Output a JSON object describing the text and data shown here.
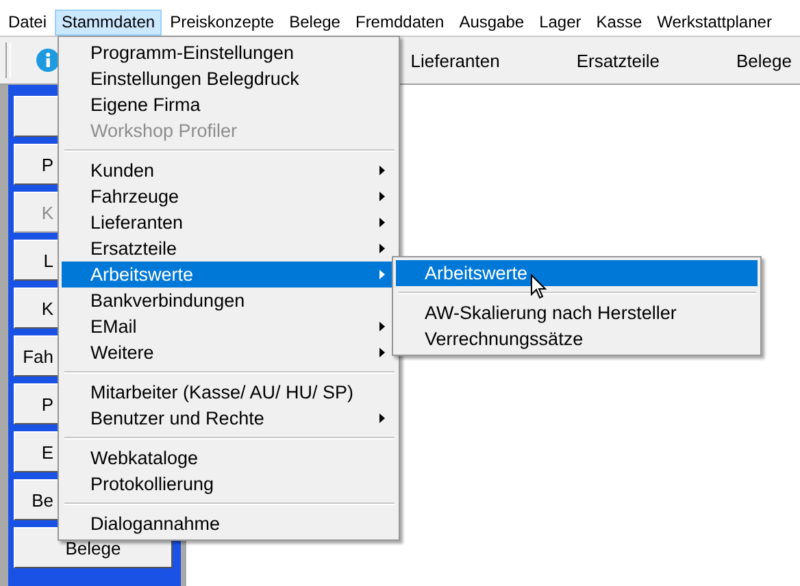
{
  "menu_bar": [
    {
      "label": "Datei",
      "selected": false
    },
    {
      "label": "Stammdaten",
      "selected": true
    },
    {
      "label": "Preiskonzepte",
      "selected": false
    },
    {
      "label": "Belege",
      "selected": false
    },
    {
      "label": "Fremddaten",
      "selected": false
    },
    {
      "label": "Ausgabe",
      "selected": false
    },
    {
      "label": "Lager",
      "selected": false
    },
    {
      "label": "Kasse",
      "selected": false
    },
    {
      "label": "Werkstattplaner",
      "selected": false
    }
  ],
  "toolbar": {
    "items": [
      "Lieferanten",
      "Ersatzteile",
      "Belege"
    ]
  },
  "sidebar": {
    "buttons": [
      {
        "kind": "partial",
        "disabled": false
      },
      {
        "kind": "partial",
        "label": "P",
        "disabled": false
      },
      {
        "kind": "partial",
        "label": "K",
        "disabled": true
      },
      {
        "kind": "partial",
        "label": "L",
        "disabled": false
      },
      {
        "kind": "partial",
        "label": "K",
        "disabled": false
      },
      {
        "kind": "partial",
        "label": "Fah",
        "disabled": false
      },
      {
        "kind": "partial",
        "label": "P",
        "disabled": false
      },
      {
        "kind": "partial",
        "label": "E",
        "disabled": false
      },
      {
        "kind": "partial",
        "label": "Be",
        "disabled": false
      },
      {
        "kind": "full",
        "label": "Belege",
        "disabled": false
      }
    ]
  },
  "stammdaten_menu": [
    {
      "kind": "item",
      "label": "Programm-Einstellungen",
      "submenu": false,
      "disabled": false,
      "selected": false
    },
    {
      "kind": "item",
      "label": "Einstellungen Belegdruck",
      "submenu": false,
      "disabled": false,
      "selected": false
    },
    {
      "kind": "item",
      "label": "Eigene Firma",
      "submenu": false,
      "disabled": false,
      "selected": false
    },
    {
      "kind": "item",
      "label": "Workshop Profiler",
      "submenu": false,
      "disabled": true,
      "selected": false
    },
    {
      "kind": "separator"
    },
    {
      "kind": "item",
      "label": "Kunden",
      "submenu": true,
      "disabled": false,
      "selected": false
    },
    {
      "kind": "item",
      "label": "Fahrzeuge",
      "submenu": true,
      "disabled": false,
      "selected": false
    },
    {
      "kind": "item",
      "label": "Lieferanten",
      "submenu": true,
      "disabled": false,
      "selected": false
    },
    {
      "kind": "item",
      "label": "Ersatzteile",
      "submenu": true,
      "disabled": false,
      "selected": false
    },
    {
      "kind": "item",
      "label": "Arbeitswerte",
      "submenu": true,
      "disabled": false,
      "selected": true
    },
    {
      "kind": "item",
      "label": "Bankverbindungen",
      "submenu": false,
      "disabled": false,
      "selected": false
    },
    {
      "kind": "item",
      "label": "EMail",
      "submenu": true,
      "disabled": false,
      "selected": false
    },
    {
      "kind": "item",
      "label": "Weitere",
      "submenu": true,
      "disabled": false,
      "selected": false
    },
    {
      "kind": "separator"
    },
    {
      "kind": "item",
      "label": "Mitarbeiter (Kasse/ AU/ HU/ SP)",
      "submenu": false,
      "disabled": false,
      "selected": false
    },
    {
      "kind": "item",
      "label": "Benutzer und Rechte",
      "submenu": true,
      "disabled": false,
      "selected": false
    },
    {
      "kind": "separator"
    },
    {
      "kind": "item",
      "label": "Webkataloge",
      "submenu": false,
      "disabled": false,
      "selected": false
    },
    {
      "kind": "item",
      "label": "Protokollierung",
      "submenu": false,
      "disabled": false,
      "selected": false
    },
    {
      "kind": "separator"
    },
    {
      "kind": "item",
      "label": "Dialogannahme",
      "submenu": false,
      "disabled": false,
      "selected": false
    }
  ],
  "arbeitswerte_submenu": [
    {
      "kind": "item",
      "label": "Arbeitswerte",
      "submenu": false,
      "disabled": false,
      "selected": true
    },
    {
      "kind": "separator"
    },
    {
      "kind": "item",
      "label": "AW-Skalierung nach Hersteller",
      "submenu": false,
      "disabled": false,
      "selected": false
    },
    {
      "kind": "item",
      "label": "Verrechnungssätze",
      "submenu": false,
      "disabled": false,
      "selected": false
    }
  ]
}
